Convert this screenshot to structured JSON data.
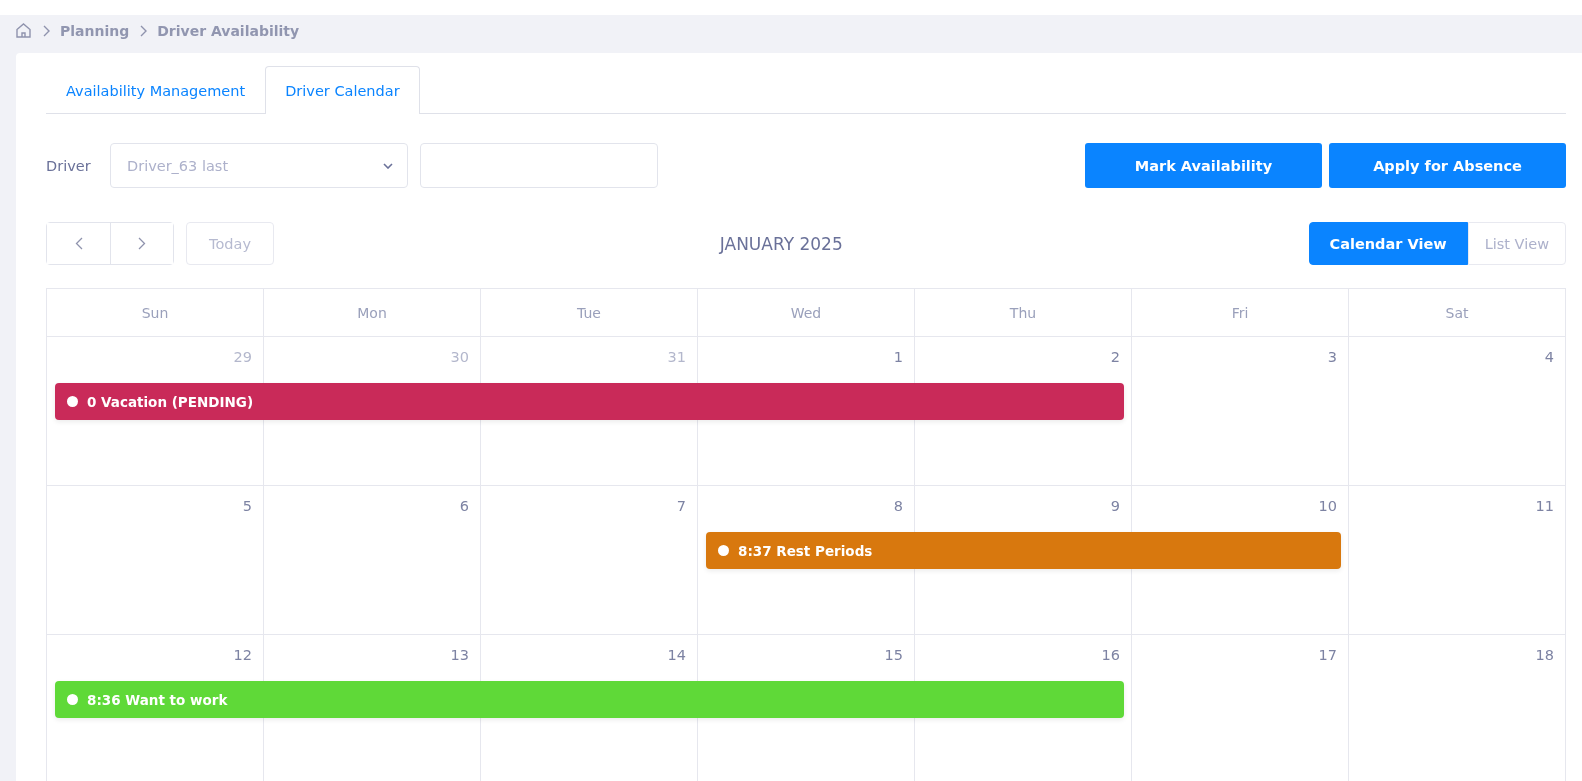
{
  "breadcrumb": [
    "Planning",
    "Driver Availability"
  ],
  "tabs": [
    {
      "label": "Availability Management",
      "selected": false
    },
    {
      "label": "Driver Calendar",
      "selected": true
    }
  ],
  "filter": {
    "label": "Driver",
    "select_value": "Driver_63 last"
  },
  "actions": [
    "Mark Availability",
    "Apply for Absence"
  ],
  "nav": {
    "today": "Today",
    "title": "JANUARY 2025"
  },
  "views": [
    {
      "label": "Calendar View",
      "selected": true
    },
    {
      "label": "List View",
      "selected": false
    }
  ],
  "weekdays": [
    "Sun",
    "Mon",
    "Tue",
    "Wed",
    "Thu",
    "Fri",
    "Sat"
  ],
  "weeks": [
    {
      "days": [
        {
          "label": "29",
          "other_month": true
        },
        {
          "label": "30",
          "other_month": true
        },
        {
          "label": "31",
          "other_month": true
        },
        {
          "label": "1",
          "other_month": false
        },
        {
          "label": "2",
          "other_month": false
        },
        {
          "label": "3",
          "other_month": false
        },
        {
          "label": "4",
          "other_month": false
        }
      ],
      "events": [
        {
          "title": "0 Vacation (PENDING)",
          "color": "#c92a59",
          "covers": [
            true,
            true,
            true,
            true,
            true,
            false,
            false
          ]
        }
      ]
    },
    {
      "days": [
        {
          "label": "5",
          "other_month": false
        },
        {
          "label": "6",
          "other_month": false
        },
        {
          "label": "7",
          "other_month": false
        },
        {
          "label": "8",
          "other_month": false
        },
        {
          "label": "9",
          "other_month": false
        },
        {
          "label": "10",
          "other_month": false
        },
        {
          "label": "11",
          "other_month": false
        }
      ],
      "events": [
        {
          "title": "8:37 Rest Periods",
          "color": "#d8780e",
          "covers": [
            false,
            false,
            false,
            true,
            true,
            true,
            false
          ]
        }
      ]
    },
    {
      "days": [
        {
          "label": "12",
          "other_month": false
        },
        {
          "label": "13",
          "other_month": false
        },
        {
          "label": "14",
          "other_month": false
        },
        {
          "label": "15",
          "other_month": false
        },
        {
          "label": "16",
          "other_month": false
        },
        {
          "label": "17",
          "other_month": false
        },
        {
          "label": "18",
          "other_month": false
        }
      ],
      "events": [
        {
          "title": "8:36 Want to work",
          "color": "#5fd938",
          "covers": [
            true,
            true,
            true,
            true,
            true,
            false,
            false
          ]
        }
      ]
    }
  ]
}
